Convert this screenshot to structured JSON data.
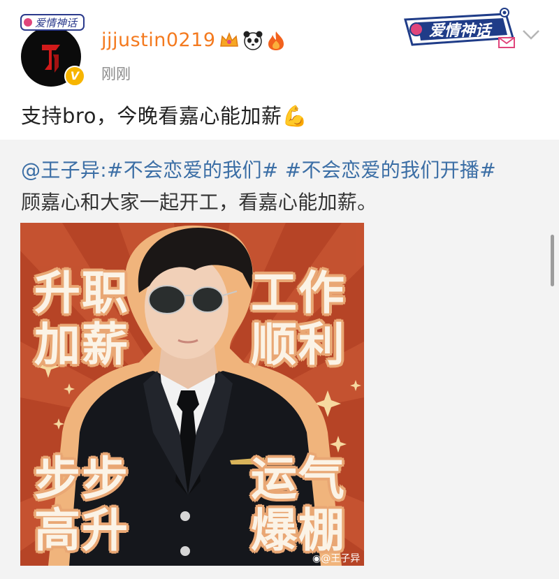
{
  "post": {
    "username": "jjjustin0219",
    "timestamp": "刚刚",
    "text": "支持bro，今晚看嘉心能加薪",
    "text_emoji": "💪",
    "user_badges": [
      "crown-badge",
      "panda-badge",
      "fire-badge"
    ],
    "brand_sticker_text": "爱情神话"
  },
  "repost": {
    "author_mention": "@王子异",
    "hashtags_line": "@王子异:#不会恋爱的我们# #不会恋爱的我们开播#",
    "body": "顾嘉心和大家一起开工，看嘉心能加薪。",
    "poster": {
      "slogans": {
        "top_left": "升职\n加薪",
        "top_right": "工作\n顺利",
        "bottom_left": "步步\n高升",
        "bottom_right": "运气\n爆棚"
      },
      "watermark": "@王子异"
    }
  },
  "colors": {
    "username": "#f47a1f",
    "link": "#3b6ea5",
    "poster_bg": "#b64426",
    "verified": "#f7b500"
  }
}
